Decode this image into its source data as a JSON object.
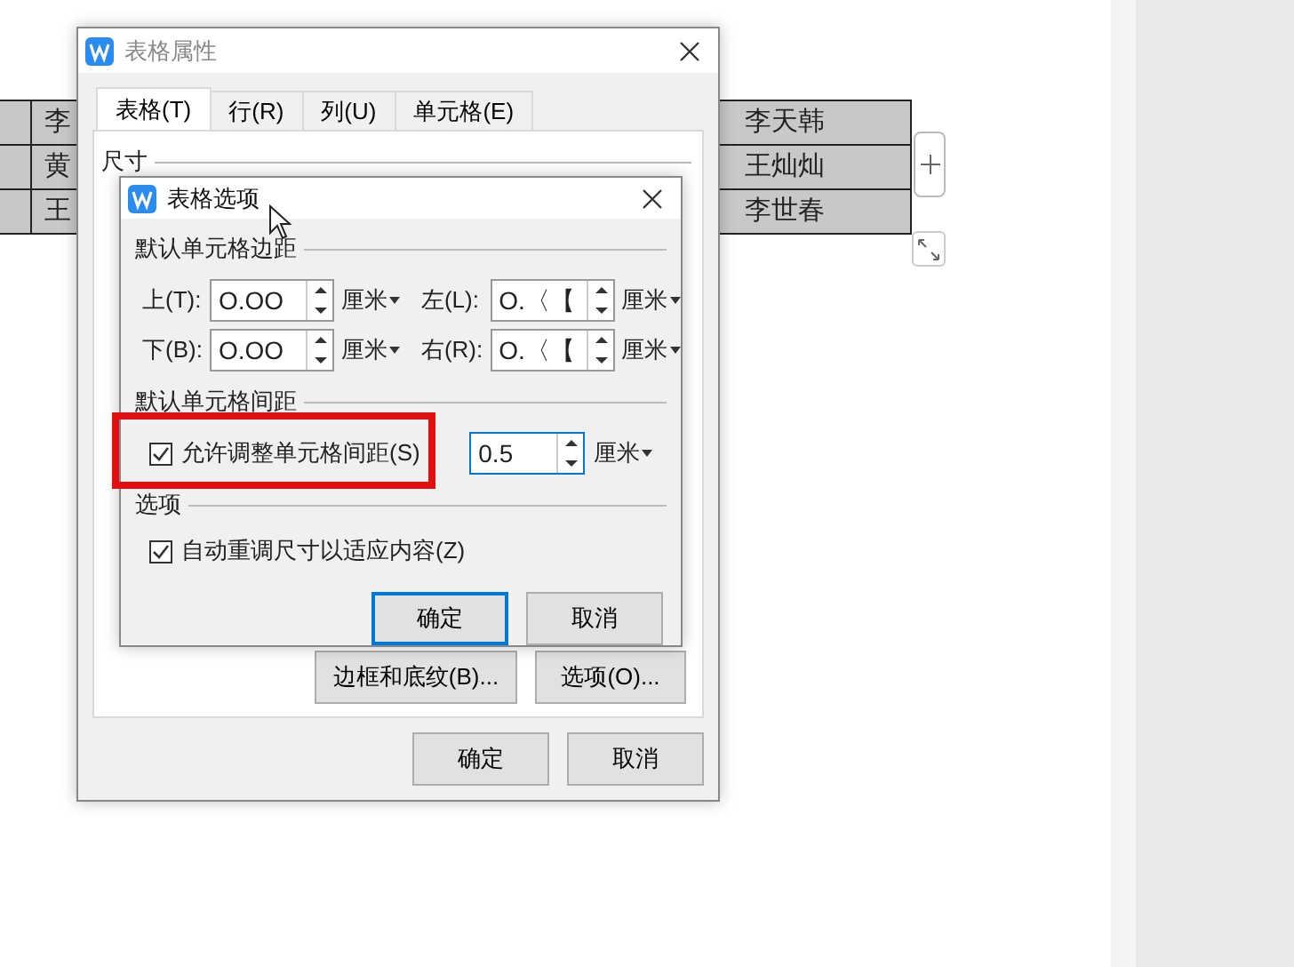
{
  "document": {
    "table_rows": [
      {
        "first": "李",
        "last": "李天韩"
      },
      {
        "first": "黄",
        "last": "王灿灿"
      },
      {
        "first": "王",
        "last": "李世春"
      }
    ]
  },
  "outer_dialog": {
    "title": "表格属性",
    "tabs": [
      {
        "label": "表格(T)",
        "selected": true
      },
      {
        "label": "行(R)",
        "selected": false
      },
      {
        "label": "列(U)",
        "selected": false
      },
      {
        "label": "单元格(E)",
        "selected": false
      }
    ],
    "section_label": "尺寸",
    "buttons": [
      "边框和底纹(B)...",
      "选项(O)..."
    ],
    "footer_buttons": [
      "确定",
      "取消"
    ]
  },
  "inner_dialog": {
    "title": "表格选项",
    "margins_label": "默认单元格边距",
    "margins": [
      {
        "label": "上(T):",
        "value": "O.OO",
        "unit": "厘米"
      },
      {
        "label": "左(L):",
        "value": "O.〈【",
        "unit": "厘米"
      },
      {
        "label": "下(B):",
        "value": "O.OO",
        "unit": "厘米"
      },
      {
        "label": "右(R):",
        "value": "O.〈【",
        "unit": "厘米"
      }
    ],
    "spacing_label": "默认单元格间距",
    "spacing_option": {
      "label": "允许调整单元格间距(S)",
      "checked": true
    },
    "spacing_value": "0.5",
    "spacing_unit": "厘米",
    "options_label": "选项",
    "options": [
      {
        "label": "自动重调尺寸以适应内容(Z)",
        "checked": true
      }
    ],
    "buttons": [
      "确定",
      "取消"
    ]
  }
}
